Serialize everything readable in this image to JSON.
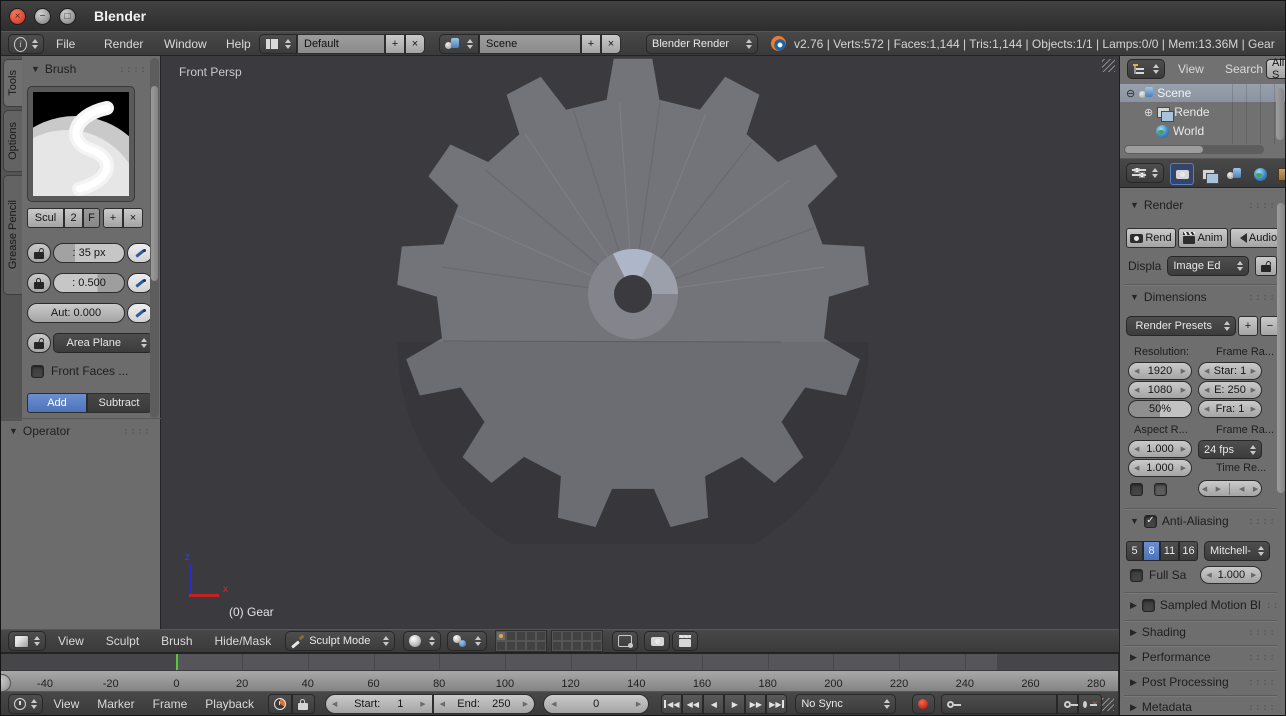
{
  "titlebar": {
    "title": "Blender"
  },
  "menubar": {
    "menus": [
      "File",
      "Render",
      "Window",
      "Help"
    ],
    "layout_name": "Default",
    "scene_name": "Scene",
    "engine": "Blender Render",
    "stats": "v2.76 | Verts:572 | Faces:1,144 | Tris:1,144 | Objects:1/1 | Lamps:0/0 | Mem:13.36M | Gear"
  },
  "tool_shelf": {
    "tabs": [
      "Tools",
      "Options",
      "Grease Pencil"
    ],
    "brush": {
      "panel_title": "Brush",
      "datablock_name": "Scul",
      "users_count": "2",
      "fake_user": "F",
      "radius": ": 35 px",
      "strength": ": 0.500",
      "autosmooth": "Aut: 0.000",
      "sculpt_plane": "Area Plane",
      "front_faces": "Front Faces ...",
      "add_label": "Add",
      "subtract_label": "Subtract"
    },
    "operator_panel_title": "Operator"
  },
  "viewport": {
    "view_label": "Front Persp",
    "object_info": "(0) Gear",
    "axis": {
      "x": "x",
      "z": "z"
    },
    "header": {
      "menus": [
        "View",
        "Sculpt",
        "Brush",
        "Hide/Mask"
      ],
      "mode": "Sculpt Mode"
    }
  },
  "timeline": {
    "ticks": [
      "-40",
      "-20",
      "0",
      "20",
      "40",
      "60",
      "80",
      "100",
      "120",
      "140",
      "160",
      "180",
      "200",
      "220",
      "240",
      "260",
      "280"
    ],
    "footer": {
      "menus": [
        "View",
        "Marker",
        "Frame",
        "Playback"
      ],
      "start_label": "Start:",
      "start_value": "1",
      "end_label": "End:",
      "end_value": "250",
      "current_frame": "0",
      "sync_mode": "No Sync"
    }
  },
  "outliner": {
    "header_items": [
      "View",
      "Search"
    ],
    "scenes_filter": "All S",
    "tree": [
      {
        "label": "Scene"
      },
      {
        "label": "Rende"
      },
      {
        "label": "World"
      }
    ]
  },
  "properties": {
    "render_panel": {
      "title": "Render",
      "render_button": "Rend",
      "anim_button": "Anim",
      "audio_button": "Audio",
      "display_label": "Displa",
      "display_value": "Image Ed"
    },
    "dimensions_panel": {
      "title": "Dimensions",
      "presets": "Render Presets",
      "resolution_label": "Resolution:",
      "res_x": "1920",
      "res_y": "1080",
      "res_pct": "50%",
      "frame_range_label": "Frame Ra...",
      "frame_start": "Star: 1",
      "frame_end": "E: 250",
      "frame_step": "Fra: 1",
      "aspect_label": "Aspect R...",
      "aspect_x": "1.000",
      "aspect_y": "1.000",
      "frame_rate_label": "Frame Ra...",
      "fps": "24 fps",
      "time_remap_label": "Time Re..."
    },
    "antialiasing_panel": {
      "title": "Anti-Aliasing",
      "samples": [
        "5",
        "8",
        "11",
        "16"
      ],
      "active_sample": "8",
      "filter": "Mitchell-",
      "full_sample_label": "Full Sa",
      "filter_size": "1.000"
    },
    "collapsed_panels": [
      "Sampled Motion Bl",
      "Shading",
      "Performance",
      "Post Processing",
      "Metadata"
    ]
  },
  "colors": {
    "accent_blue": "#5680c2",
    "current_frame_green": "#58c73c",
    "close_button_orange": "#df4b3a",
    "record_red": "#cc2b1e",
    "viewport_bg": "#3b3b3f",
    "gear_gray": "#73737a"
  }
}
